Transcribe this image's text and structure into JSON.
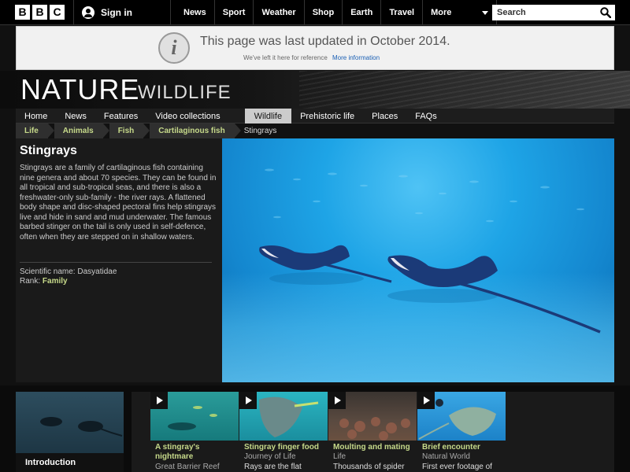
{
  "topbar": {
    "logo_letters": [
      "B",
      "B",
      "C"
    ],
    "signin_label": "Sign in",
    "nav": [
      "News",
      "Sport",
      "Weather",
      "Shop",
      "Earth",
      "Travel"
    ],
    "more_label": "More",
    "search_placeholder": "Search"
  },
  "notice": {
    "icon_letter": "i",
    "message": "This page was last updated in October 2014.",
    "sub_text": "We've left it here for reference",
    "more_info_link": "More information"
  },
  "header": {
    "title": "NATURE",
    "subtitle": "WILDLIFE"
  },
  "section_nav": [
    {
      "label": "Home",
      "active": false
    },
    {
      "label": "News",
      "active": false
    },
    {
      "label": "Features",
      "active": false
    },
    {
      "label": "Video collections",
      "active": false
    },
    {
      "label": "Wildlife",
      "active": true
    },
    {
      "label": "Prehistoric life",
      "active": false
    },
    {
      "label": "Places",
      "active": false
    },
    {
      "label": "FAQs",
      "active": false
    }
  ],
  "breadcrumb": {
    "items": [
      "Life",
      "Animals",
      "Fish",
      "Cartilaginous fish"
    ],
    "current": "Stingrays"
  },
  "article": {
    "title": "Stingrays",
    "description": "Stingrays are a family of cartilaginous fish containing nine genera and about 70 species. They can be found in all tropical and sub-tropical seas, and there is also a freshwater-only sub-family - the river rays. A flattened body shape and disc-shaped pectoral fins help stingrays live and hide in sand and mud underwater. The famous barbed stinger on the tail is only used in self-defence, often when they are stepped on in shallow waters.",
    "scientific_name": "Scientific name: Dasyatidae",
    "rank_label": "Rank:",
    "rank_value": "Family"
  },
  "intro_tile": {
    "label": "Introduction"
  },
  "video_cards": [
    {
      "title_line1": "A stingray's",
      "title_line2": "nightmare",
      "source": "Great Barrier Reef",
      "blurb": ""
    },
    {
      "title_line1": "Stingray finger food",
      "title_line2": "",
      "source": "Journey of Life",
      "blurb": "Rays are the flat"
    },
    {
      "title_line1": "Moulting and mating",
      "title_line2": "",
      "source": "Life",
      "blurb": "Thousands of spider"
    },
    {
      "title_line1": "Brief encounter",
      "title_line2": "",
      "source": "Natural World",
      "blurb": "First ever footage of"
    }
  ],
  "colors": {
    "accent_green": "#c6d98a",
    "link_blue": "#1a5fb4",
    "water_blue": "#1ea4e6"
  }
}
